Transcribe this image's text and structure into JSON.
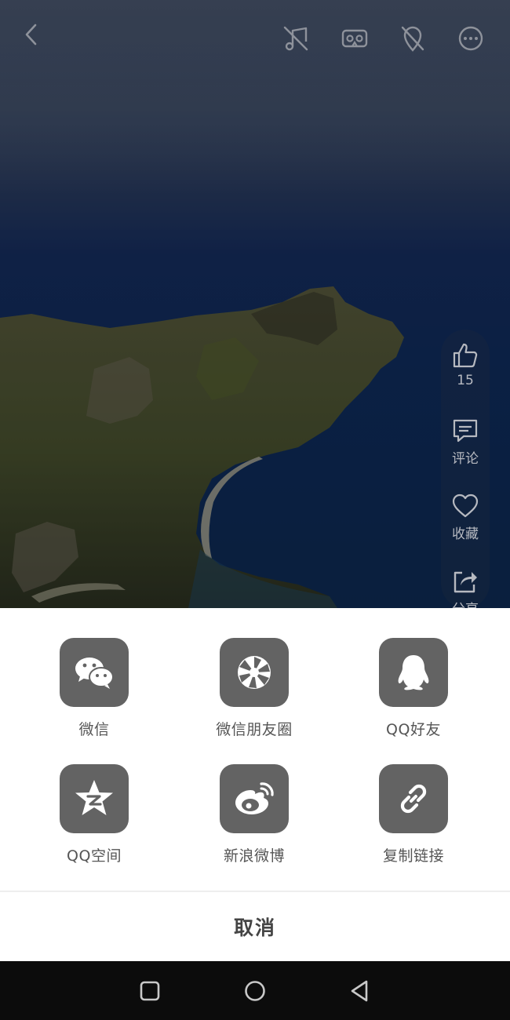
{
  "top_bar": {
    "icons": [
      "back-icon",
      "music-off-icon",
      "vr-headset-icon",
      "location-off-icon",
      "more-icon"
    ]
  },
  "rail": {
    "like_count": "15",
    "comment_label": "评论",
    "favorite_label": "收藏",
    "share_label": "分享"
  },
  "share_sheet": {
    "items": [
      {
        "label": "微信",
        "icon": "wechat-icon"
      },
      {
        "label": "微信朋友圈",
        "icon": "moments-icon"
      },
      {
        "label": "QQ好友",
        "icon": "qq-icon"
      },
      {
        "label": "QQ空间",
        "icon": "qzone-icon"
      },
      {
        "label": "新浪微博",
        "icon": "weibo-icon"
      },
      {
        "label": "复制链接",
        "icon": "link-icon"
      }
    ],
    "cancel_label": "取消"
  },
  "colors": {
    "tile_bg": "#636363",
    "sheet_bg": "#ffffff",
    "navbar_bg": "#0c0c0c"
  }
}
